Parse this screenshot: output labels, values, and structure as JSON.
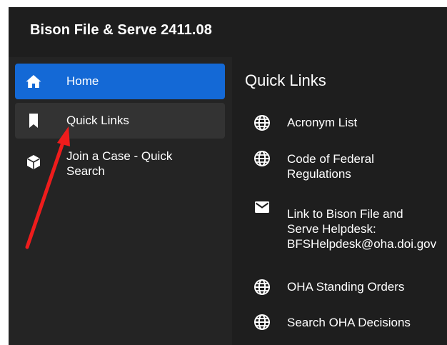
{
  "header": {
    "app_title": "Bison File & Serve 2411.08"
  },
  "sidebar": {
    "items": [
      {
        "label": "Home",
        "icon": "home-icon",
        "active": true
      },
      {
        "label": "Quick Links",
        "icon": "bookmark-icon",
        "hovered": true
      },
      {
        "label": "Join a Case - Quick Search",
        "icon": "cube-icon"
      }
    ]
  },
  "main": {
    "title": "Quick Links",
    "links": [
      {
        "label": "Acronym List",
        "icon": "globe-icon"
      },
      {
        "label": "Code of Federal Regulations",
        "icon": "globe-icon"
      },
      {
        "label": "Link to Bison File and Serve Helpdesk: BFSHelpdesk@oha.doi.gov",
        "icon": "mail-icon"
      },
      {
        "label": "OHA Standing Orders",
        "icon": "globe-icon"
      },
      {
        "label": "Search OHA Decisions",
        "icon": "globe-icon"
      }
    ]
  },
  "colors": {
    "active_nav": "#1469d6",
    "hover_nav": "#333333",
    "background": "#242424",
    "panel": "#1e1e1e",
    "annotation_arrow": "#ee1c1c"
  }
}
